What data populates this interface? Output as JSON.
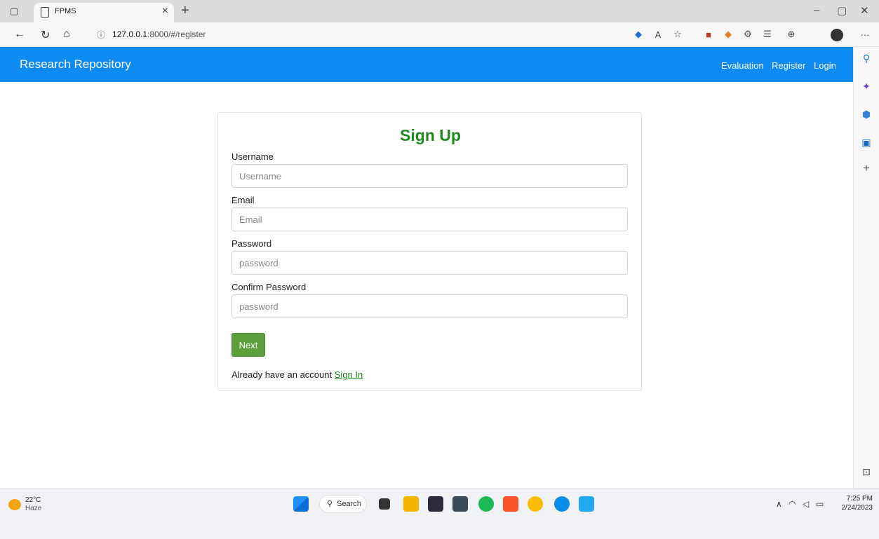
{
  "browser": {
    "tab_title": "FPMS",
    "tab_close": "×",
    "new_tab": "+",
    "url_host": "127.0.0.1",
    "url_path": ":8000/#/register"
  },
  "navbar": {
    "brand": "Research Repository",
    "links": [
      "Evaluation",
      "Register",
      "Login"
    ]
  },
  "form": {
    "title": "Sign Up",
    "username_label": "Username",
    "username_placeholder": "Username",
    "email_label": "Email",
    "email_placeholder": "Email",
    "password_label": "Password",
    "password_placeholder": "password",
    "confirm_label": "Confirm Password",
    "confirm_placeholder": "password",
    "next_button": "Next",
    "already_text": "Already have an account ",
    "signin_link": "Sign In"
  },
  "taskbar": {
    "weather_temp": "22°C",
    "weather_desc": "Haze",
    "search_label": "Search",
    "time": "7:25 PM",
    "date": "2/24/2023"
  },
  "colors": {
    "navbar": "#0d8bf2",
    "title_green": "#1e8a1e",
    "button_green": "#5c9f3c"
  }
}
